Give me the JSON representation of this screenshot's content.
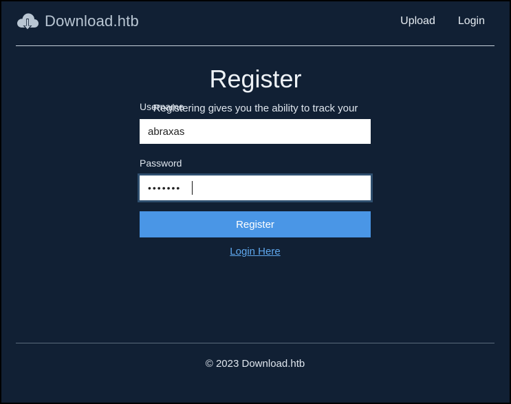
{
  "header": {
    "brand_icon": "cloud-download-icon",
    "brand_name": "Download.htb",
    "nav": {
      "upload": "Upload",
      "login": "Login"
    }
  },
  "main": {
    "title": "Register",
    "subtitle": "Registering gives you the ability to track your uploaded files and delete previous files.",
    "form": {
      "username_label": "Username",
      "username_value": "abraxas",
      "password_label": "Password",
      "password_value": "•••••••",
      "submit_label": "Register",
      "login_link": "Login Here"
    }
  },
  "footer": {
    "text": "© 2023 Download.htb"
  },
  "colors": {
    "background": "#112034",
    "accent": "#4a96e6",
    "link": "#5fa8ee"
  }
}
